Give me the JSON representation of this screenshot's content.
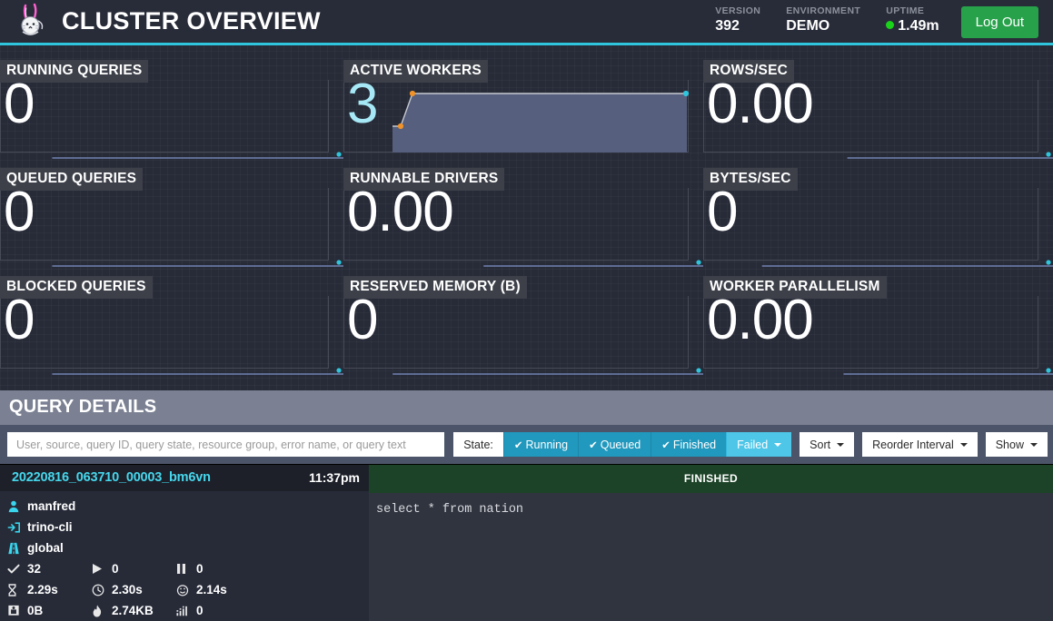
{
  "header": {
    "logo_icon": "trino-rabbit-logo",
    "title": "CLUSTER OVERVIEW",
    "stats": [
      {
        "label": "VERSION",
        "value": "392"
      },
      {
        "label": "ENVIRONMENT",
        "value": "DEMO"
      },
      {
        "label": "UPTIME",
        "value": "1.49m",
        "status_dot_color": "#19d219"
      }
    ],
    "logout_label": "Log Out",
    "accent_color": "#2ec5dd",
    "logout_color": "#27a24b"
  },
  "stat_cards": [
    {
      "label": "RUNNING QUERIES",
      "value": "0",
      "accent": false
    },
    {
      "label": "ACTIVE WORKERS",
      "value": "3",
      "accent": true
    },
    {
      "label": "ROWS/SEC",
      "value": "0.00",
      "accent": false
    },
    {
      "label": "QUEUED QUERIES",
      "value": "0",
      "accent": false
    },
    {
      "label": "RUNNABLE DRIVERS",
      "value": "0.00",
      "accent": false
    },
    {
      "label": "BYTES/SEC",
      "value": "0",
      "accent": false
    },
    {
      "label": "BLOCKED QUERIES",
      "value": "0",
      "accent": false
    },
    {
      "label": "RESERVED MEMORY (B)",
      "value": "0",
      "accent": false
    },
    {
      "label": "WORKER PARALLELISM",
      "value": "0.00",
      "accent": false
    }
  ],
  "chart_data": [
    {
      "type": "line",
      "title": "RUNNING QUERIES",
      "x": [
        0,
        1,
        2,
        3,
        4,
        5,
        6,
        7,
        8,
        9
      ],
      "values": [
        0,
        0,
        0,
        0,
        0,
        0,
        0,
        0,
        0,
        0
      ],
      "ylim": [
        0,
        1
      ],
      "grid": false,
      "legend": "none",
      "endpoint_color": "#2ec5dd"
    },
    {
      "type": "area",
      "title": "ACTIVE WORKERS",
      "x": [
        0,
        1,
        2,
        3,
        4,
        5,
        6,
        7,
        8,
        9
      ],
      "values": [
        2,
        2,
        3,
        3,
        3,
        3,
        3,
        3,
        3,
        3
      ],
      "ylim": [
        0,
        3
      ],
      "grid": false,
      "legend": "none",
      "fill_color": "#565f7d",
      "line_color": "#c6c9d1",
      "point_color": "#f0932b",
      "endpoint_color": "#2ec5dd"
    },
    {
      "type": "line",
      "title": "ROWS/SEC",
      "x": [
        0,
        1,
        2,
        3,
        4,
        5,
        6,
        7,
        8,
        9
      ],
      "values": [
        0,
        0,
        0,
        0,
        0,
        0,
        0,
        0,
        0,
        0
      ],
      "ylim": [
        0,
        1
      ],
      "grid": false,
      "legend": "none",
      "endpoint_color": "#2ec5dd"
    },
    {
      "type": "line",
      "title": "QUEUED QUERIES",
      "x": [
        0,
        1,
        2,
        3,
        4,
        5,
        6,
        7,
        8,
        9
      ],
      "values": [
        0,
        0,
        0,
        0,
        0,
        0,
        0,
        0,
        0,
        0
      ],
      "ylim": [
        0,
        1
      ],
      "grid": false,
      "legend": "none",
      "endpoint_color": "#2ec5dd"
    },
    {
      "type": "line",
      "title": "RUNNABLE DRIVERS",
      "x": [
        0,
        1,
        2,
        3,
        4,
        5,
        6,
        7,
        8,
        9
      ],
      "values": [
        0,
        0,
        0,
        0,
        0,
        0,
        0,
        0,
        0,
        0
      ],
      "ylim": [
        0,
        1
      ],
      "grid": false,
      "legend": "none",
      "endpoint_color": "#2ec5dd"
    },
    {
      "type": "line",
      "title": "BYTES/SEC",
      "x": [
        0,
        1,
        2,
        3,
        4,
        5,
        6,
        7,
        8,
        9
      ],
      "values": [
        0,
        0,
        0,
        0,
        0,
        0,
        0,
        0,
        0,
        0
      ],
      "ylim": [
        0,
        1
      ],
      "grid": false,
      "legend": "none",
      "endpoint_color": "#2ec5dd"
    },
    {
      "type": "line",
      "title": "BLOCKED QUERIES",
      "x": [
        0,
        1,
        2,
        3,
        4,
        5,
        6,
        7,
        8,
        9
      ],
      "values": [
        0,
        0,
        0,
        0,
        0,
        0,
        0,
        0,
        0,
        0
      ],
      "ylim": [
        0,
        1
      ],
      "grid": false,
      "legend": "none",
      "endpoint_color": "#2ec5dd"
    },
    {
      "type": "line",
      "title": "RESERVED MEMORY (B)",
      "x": [
        0,
        1,
        2,
        3,
        4,
        5,
        6,
        7,
        8,
        9
      ],
      "values": [
        0,
        0,
        0,
        0,
        0,
        0,
        0,
        0,
        0,
        0
      ],
      "ylim": [
        0,
        1
      ],
      "grid": false,
      "legend": "none",
      "endpoint_color": "#2ec5dd"
    },
    {
      "type": "line",
      "title": "WORKER PARALLELISM",
      "x": [
        0,
        1,
        2,
        3,
        4,
        5,
        6,
        7,
        8,
        9
      ],
      "values": [
        0,
        0,
        0,
        0,
        0,
        0,
        0,
        0,
        0,
        0
      ],
      "ylim": [
        0,
        1
      ],
      "grid": false,
      "legend": "none",
      "endpoint_color": "#2ec5dd"
    }
  ],
  "query_details": {
    "title": "QUERY DETAILS",
    "search_placeholder": "User, source, query ID, query state, resource group, error name, or query text",
    "search_value": "",
    "state_label": "State:",
    "state_buttons": [
      {
        "label": "Running",
        "checked": true,
        "style": "on"
      },
      {
        "label": "Queued",
        "checked": true,
        "style": "on"
      },
      {
        "label": "Finished",
        "checked": true,
        "style": "on"
      },
      {
        "label": "Failed",
        "checked": false,
        "style": "failed",
        "caret": true
      }
    ],
    "dropdowns": [
      {
        "label": "Sort"
      },
      {
        "label": "Reorder Interval"
      },
      {
        "label": "Show"
      }
    ],
    "rows": [
      {
        "query_id": "20220816_063710_00003_bm6vn",
        "time": "11:37pm",
        "state": "FINISHED",
        "state_color": "#1c4327",
        "user": "manfred",
        "source": "trino-cli",
        "resource_group": "global",
        "stats": [
          {
            "icon": "check-icon",
            "value": "32"
          },
          {
            "icon": "play-icon",
            "value": "0"
          },
          {
            "icon": "pause-icon",
            "value": "0"
          },
          {
            "icon": "hourglass-icon",
            "value": "2.29s"
          },
          {
            "icon": "clock-icon",
            "value": "2.30s"
          },
          {
            "icon": "stopwatch-icon",
            "value": "2.14s"
          },
          {
            "icon": "save-icon",
            "value": "0B"
          },
          {
            "icon": "fire-icon",
            "value": "2.74KB"
          },
          {
            "icon": "signal-icon",
            "value": "0"
          }
        ],
        "sql": "select * from nation"
      }
    ]
  }
}
